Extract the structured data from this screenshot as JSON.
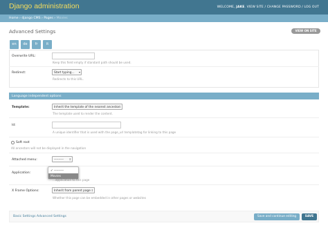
{
  "header": {
    "brand": "Django administration",
    "welcome": "WELCOME,",
    "user": "JAKE",
    "links": ". VIEW SITE / CHANGE PASSWORD / LOG OUT"
  },
  "breadcrumb": {
    "home": "Home",
    "sep": " › ",
    "cms": "django CMS",
    "pages": "Pages",
    "current": "Movies"
  },
  "page": {
    "title": "Advanced Settings",
    "view_on_site": "VIEW ON SITE"
  },
  "languages": [
    "en",
    "de",
    "fr",
    "it"
  ],
  "form": {
    "overwrite_url_label": "Overwrite URL:",
    "overwrite_url_value": "",
    "overwrite_url_help": "Keep this field empty if standard path should be used.",
    "redirect_label": "Redirect:",
    "redirect_value": "Start typing...",
    "redirect_help": "Redirects to this URL.",
    "section_title": "Language independent options",
    "template_label": "Template:",
    "template_value": "Inherit the template of the nearest ancestor",
    "template_help": "The template used to render the content.",
    "id_label": "Id:",
    "id_value": "",
    "id_help": "A unique identifier that is used with the page_url templatetag for linking to this page",
    "softroot_label": "Soft root",
    "softroot_help": "All ancestors will not be displayed in the navigation",
    "attached_menu_label": "Attached menu:",
    "attached_menu_value": "---------",
    "application_label": "Application:",
    "application_help": "...application to this page",
    "application_options": [
      "---------",
      "Movies"
    ],
    "xframe_label": "X Frame Options:",
    "xframe_value": "Inherit from parent page",
    "xframe_help": "Whether this page can be embedded in other pages or websites"
  },
  "footer": {
    "link": "Basic Settings Advanced Settings",
    "save_continue": "Save and continue editing",
    "save": "SAVE"
  }
}
